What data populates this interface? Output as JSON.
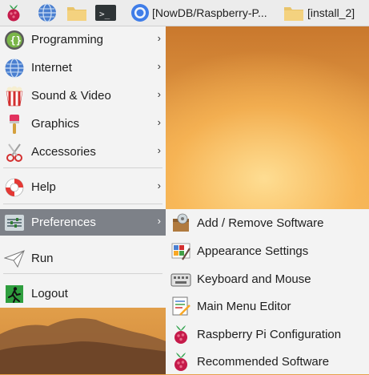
{
  "taskbar": {
    "launchers": [
      {
        "name": "raspberry-menu-icon"
      },
      {
        "name": "web-browser-icon"
      },
      {
        "name": "file-manager-icon"
      },
      {
        "name": "terminal-icon"
      }
    ],
    "tasks": [
      {
        "label": "[NowDB/Raspberry-P..."
      },
      {
        "label": "[install_2]"
      }
    ]
  },
  "menu": {
    "items": [
      {
        "label": "Programming",
        "has_submenu": true
      },
      {
        "label": "Internet",
        "has_submenu": true
      },
      {
        "label": "Sound & Video",
        "has_submenu": true
      },
      {
        "label": "Graphics",
        "has_submenu": true
      },
      {
        "label": "Accessories",
        "has_submenu": true
      },
      {
        "label": "Help",
        "has_submenu": true
      },
      {
        "label": "Preferences",
        "has_submenu": true,
        "active": true
      },
      {
        "label": "Run",
        "has_submenu": false
      },
      {
        "label": "Logout",
        "has_submenu": false
      }
    ],
    "arrow": "›"
  },
  "submenu": {
    "items": [
      {
        "label": "Add / Remove Software"
      },
      {
        "label": "Appearance Settings"
      },
      {
        "label": "Keyboard and Mouse"
      },
      {
        "label": "Main Menu Editor"
      },
      {
        "label": "Raspberry Pi Configuration"
      },
      {
        "label": "Recommended Software"
      }
    ]
  },
  "colors": {
    "menu_bg": "#f3f3f3",
    "highlight": "#7d8188",
    "taskbar_bg": "#ececec"
  }
}
